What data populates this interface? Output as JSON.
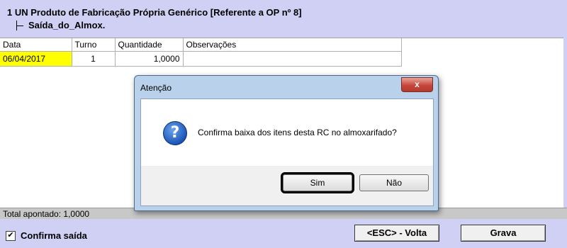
{
  "header": {
    "title": "1 UN Produto de Fabricação Própria Genérico [Referente a OP nº 8]",
    "subitem": "Saída_do_Almox."
  },
  "grid": {
    "columns": [
      "Data",
      "Turno",
      "Quantidade",
      "Observações"
    ],
    "rows": [
      {
        "data": "06/04/2017",
        "turno": "1",
        "quantidade": "1,0000",
        "observacoes": ""
      }
    ]
  },
  "status": {
    "text": "Total apontado: 1,0000"
  },
  "footer": {
    "confirm_label": "Confirma saída",
    "confirm_checked": true,
    "volta_label": "<ESC> - Volta",
    "grava_label": "Grava"
  },
  "dialog": {
    "title": "Atenção",
    "close_glyph": "x",
    "message": "Confirma baixa dos itens desta RC no almoxarifado?",
    "icon": "question-icon",
    "yes_label": "Sim",
    "no_label": "Não"
  },
  "colors": {
    "window_bg": "#cfd0f3",
    "highlight_cell": "#ffff00",
    "close_button": "#c7463a"
  }
}
